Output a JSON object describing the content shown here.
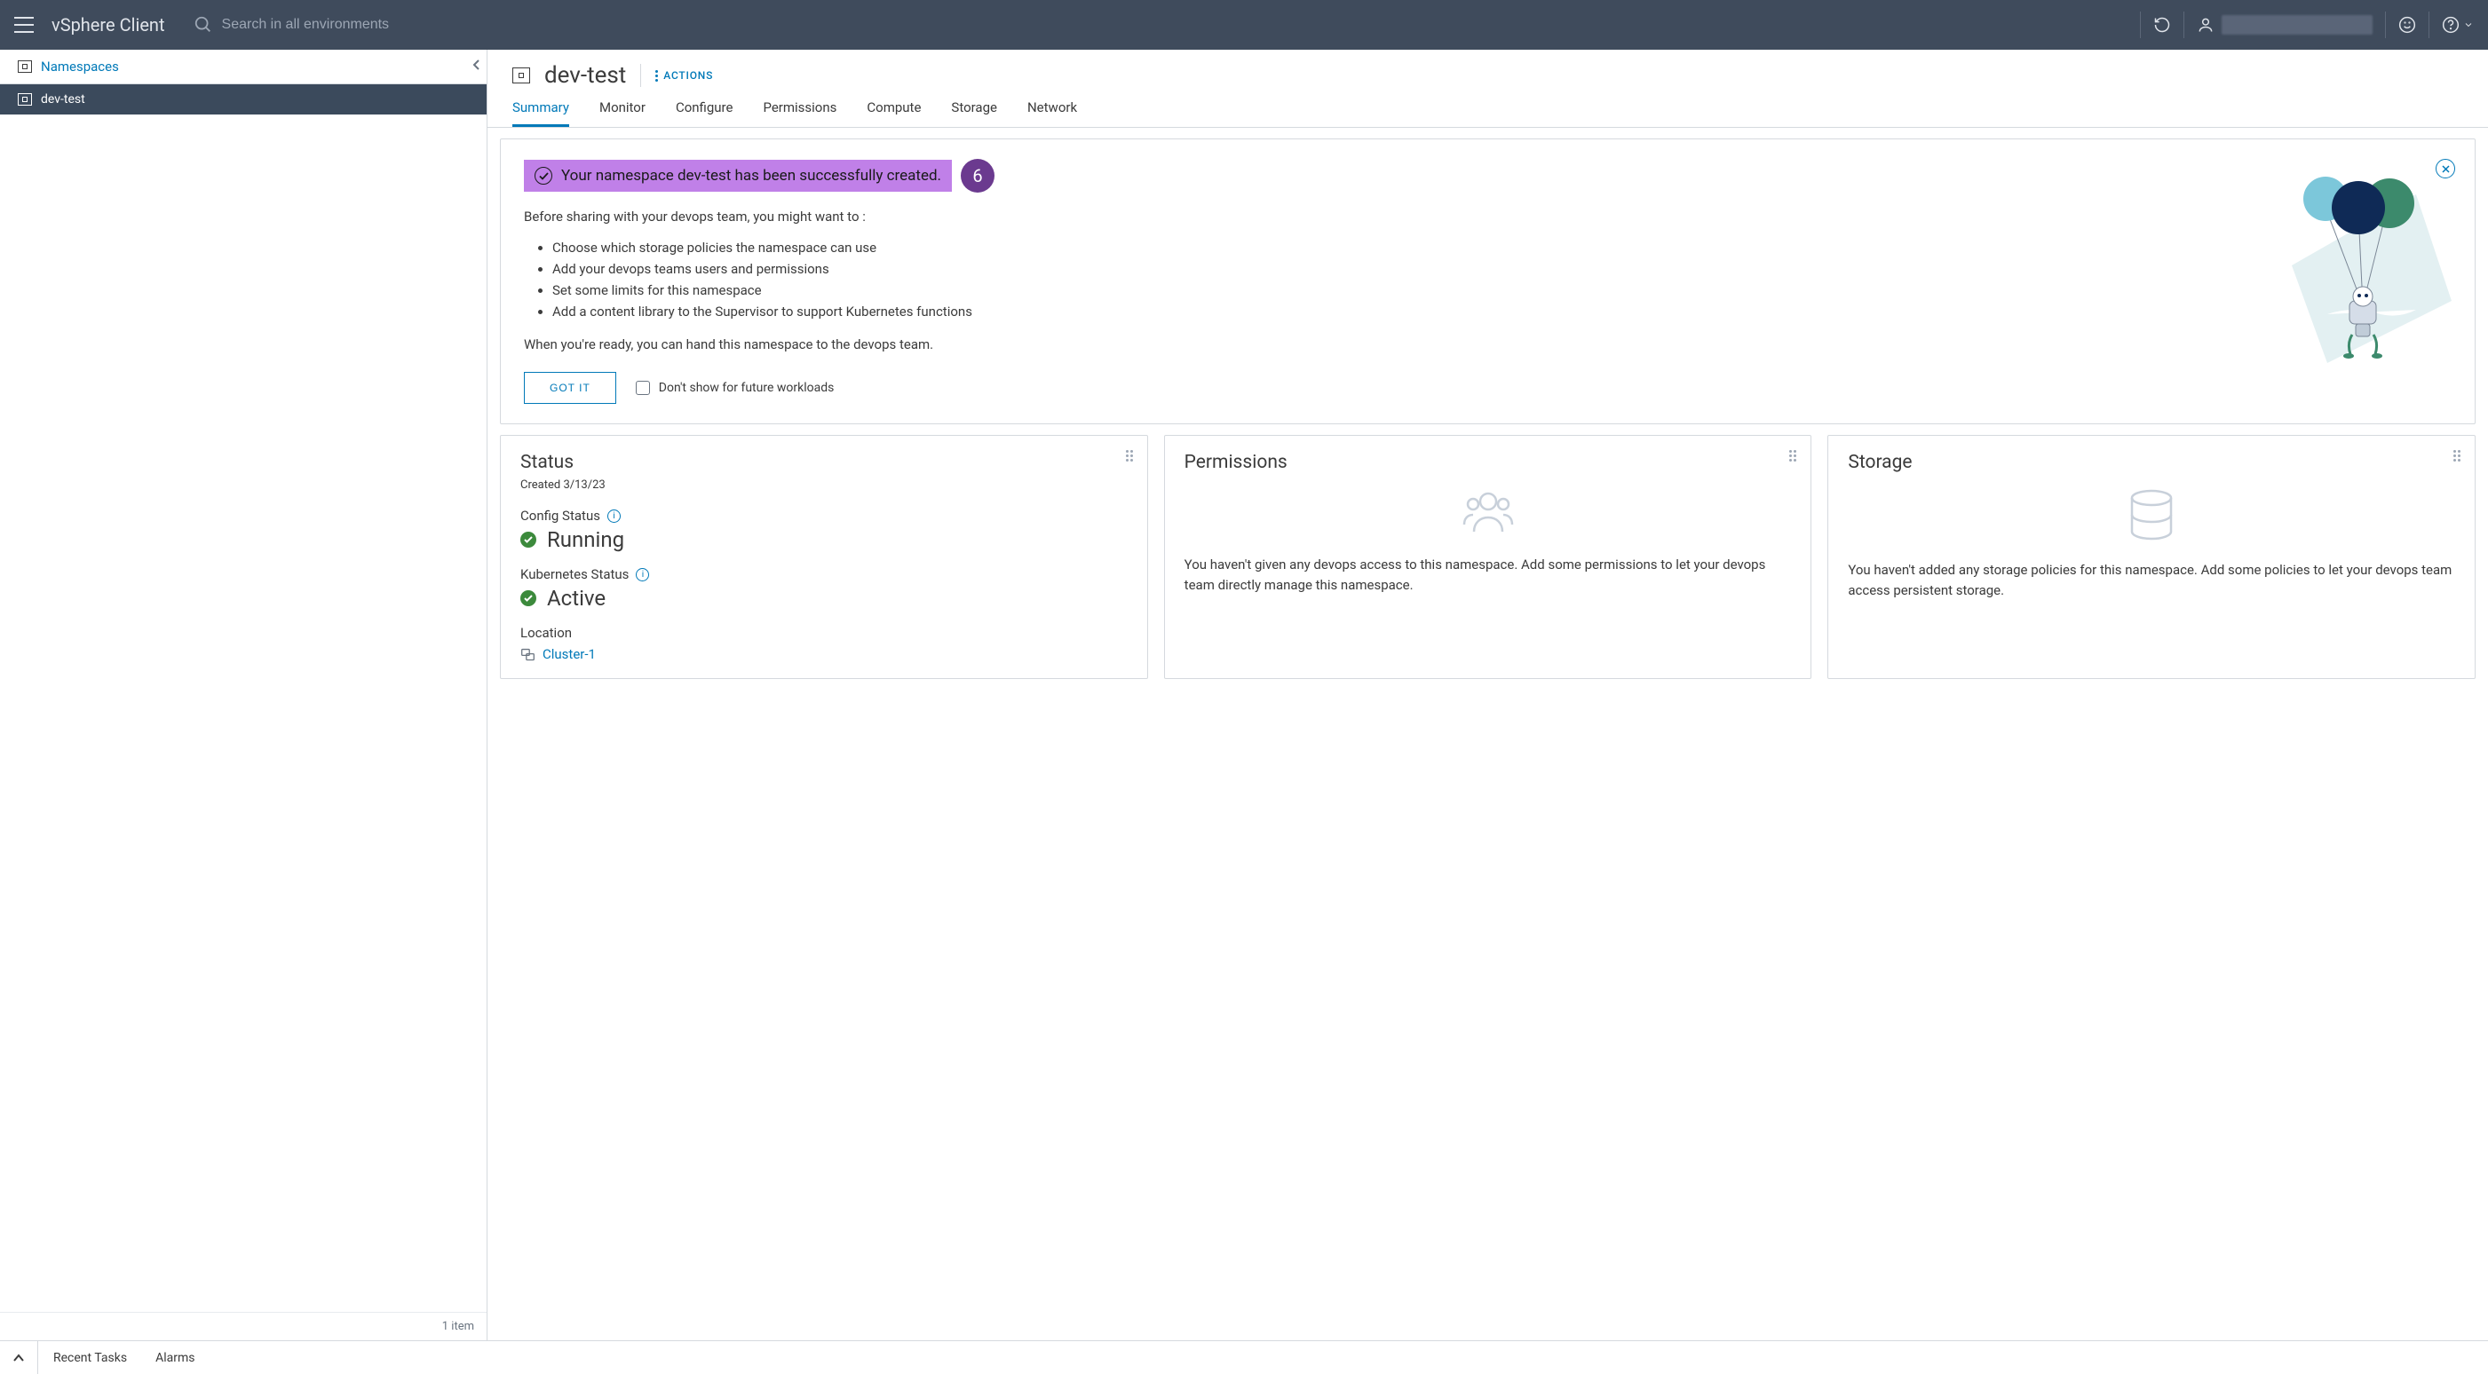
{
  "app_title": "vSphere Client",
  "search": {
    "placeholder": "Search in all environments"
  },
  "sidebar": {
    "header_label": "Namespaces",
    "items": [
      {
        "label": "dev-test"
      }
    ],
    "item_count": "1 item"
  },
  "content": {
    "title": "dev-test",
    "actions_label": "ACTIONS",
    "tabs": [
      "Summary",
      "Monitor",
      "Configure",
      "Permissions",
      "Compute",
      "Storage",
      "Network"
    ],
    "panel": {
      "success_msg": "Your namespace dev-test has been successfully created.",
      "badge_num": "6",
      "intro": "Before sharing with your devops team, you might want to :",
      "bullets": [
        "Choose which storage policies the namespace can use",
        "Add your devops teams users and permissions",
        "Set some limits for this namespace",
        "Add a content library to the Supervisor to support Kubernetes functions"
      ],
      "ready": "When you're ready, you can hand this namespace to the devops team.",
      "got_it": "GOT IT",
      "dont_show": "Don't show for future workloads"
    },
    "cards": {
      "status": {
        "title": "Status",
        "created_label": "Created",
        "created_date": "3/13/23",
        "config_label": "Config Status",
        "config_value": "Running",
        "k8s_label": "Kubernetes Status",
        "k8s_value": "Active",
        "location_label": "Location",
        "cluster_link": "Cluster-1"
      },
      "permissions": {
        "title": "Permissions",
        "desc": "You haven't given any devops access to this namespace. Add some permissions to let your devops team directly manage this namespace."
      },
      "storage": {
        "title": "Storage",
        "desc": "You haven't added any storage policies for this namespace. Add some policies to let your devops team access persistent storage."
      }
    }
  },
  "bottom_bar": {
    "recent_tasks": "Recent Tasks",
    "alarms": "Alarms"
  }
}
